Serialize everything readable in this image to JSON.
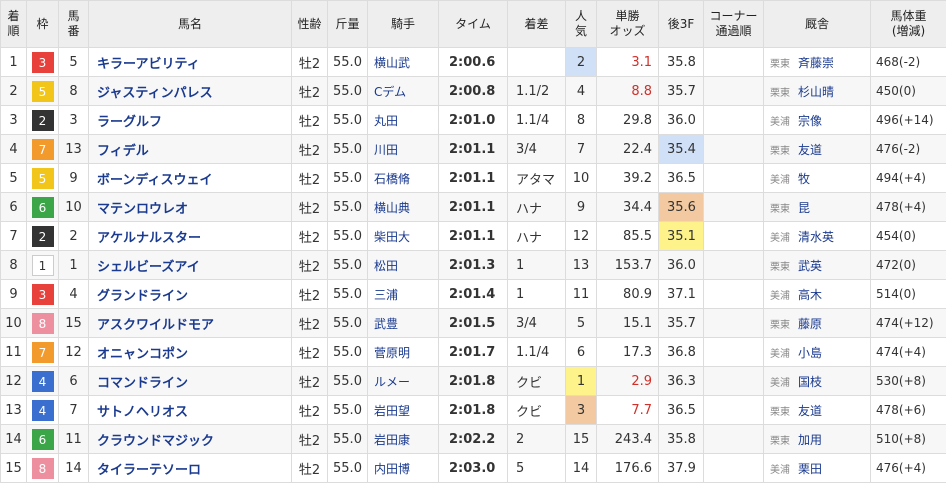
{
  "headers": [
    {
      "key": "rank",
      "lines": [
        "着",
        "順"
      ]
    },
    {
      "key": "waku",
      "lines": [
        "枠"
      ]
    },
    {
      "key": "num",
      "lines": [
        "馬",
        "番"
      ]
    },
    {
      "key": "horse",
      "lines": [
        "馬名"
      ]
    },
    {
      "key": "sexage",
      "lines": [
        "性齢"
      ]
    },
    {
      "key": "weight",
      "lines": [
        "斤量"
      ]
    },
    {
      "key": "jockey",
      "lines": [
        "騎手"
      ]
    },
    {
      "key": "time",
      "lines": [
        "タイム"
      ]
    },
    {
      "key": "margin",
      "lines": [
        "着差"
      ]
    },
    {
      "key": "pop",
      "lines": [
        "人",
        "気"
      ]
    },
    {
      "key": "odds",
      "lines": [
        "単勝",
        "オッズ"
      ]
    },
    {
      "key": "last3f",
      "lines": [
        "後3F"
      ]
    },
    {
      "key": "corner",
      "lines": [
        "コーナー",
        "通過順"
      ]
    },
    {
      "key": "trainer",
      "lines": [
        "厩舎"
      ]
    },
    {
      "key": "bodyweight",
      "lines": [
        "馬体重",
        "(増減)"
      ]
    }
  ],
  "waku_colors": {
    "1": {
      "bg": "#ffffff",
      "fg": "#333333",
      "border": "#cccccc"
    },
    "2": {
      "bg": "#333333",
      "fg": "#ffffff",
      "border": "#333333"
    },
    "3": {
      "bg": "#e8403a",
      "fg": "#ffffff",
      "border": "#e8403a"
    },
    "4": {
      "bg": "#3a6fcf",
      "fg": "#ffffff",
      "border": "#3a6fcf"
    },
    "5": {
      "bg": "#f2c51b",
      "fg": "#ffffff",
      "border": "#f2c51b"
    },
    "6": {
      "bg": "#3aa648",
      "fg": "#ffffff",
      "border": "#3aa648"
    },
    "7": {
      "bg": "#f39a2c",
      "fg": "#ffffff",
      "border": "#f39a2c"
    },
    "8": {
      "bg": "#ee8fa0",
      "fg": "#ffffff",
      "border": "#ee8fa0"
    }
  },
  "rows": [
    {
      "rank": "1",
      "waku": "3",
      "num": "5",
      "horse": "キラーアビリティ",
      "sexage": "牡2",
      "weight": "55.0",
      "jockey": "横山武",
      "time": "2:00.6",
      "margin": "",
      "pop": "2",
      "odds": "3.1",
      "odds_red": true,
      "last3f": "35.8",
      "last3f_hl": "",
      "corner": "",
      "region": "栗東",
      "trainer": "斉藤崇",
      "bodyweight": "468(-2)"
    },
    {
      "rank": "2",
      "waku": "5",
      "num": "8",
      "horse": "ジャスティンパレス",
      "sexage": "牡2",
      "weight": "55.0",
      "jockey": "Cデム",
      "time": "2:00.8",
      "margin": "1.1/2",
      "pop": "4",
      "odds": "8.8",
      "odds_red": true,
      "last3f": "35.7",
      "last3f_hl": "",
      "corner": "",
      "region": "栗東",
      "trainer": "杉山晴",
      "bodyweight": "450(0)"
    },
    {
      "rank": "3",
      "waku": "2",
      "num": "3",
      "horse": "ラーグルフ",
      "sexage": "牡2",
      "weight": "55.0",
      "jockey": "丸田",
      "time": "2:01.0",
      "margin": "1.1/4",
      "pop": "8",
      "odds": "29.8",
      "odds_red": false,
      "last3f": "36.0",
      "last3f_hl": "",
      "corner": "",
      "region": "美浦",
      "trainer": "宗像",
      "bodyweight": "496(+14)"
    },
    {
      "rank": "4",
      "waku": "7",
      "num": "13",
      "horse": "フィデル",
      "sexage": "牡2",
      "weight": "55.0",
      "jockey": "川田",
      "time": "2:01.1",
      "margin": "3/4",
      "pop": "7",
      "odds": "22.4",
      "odds_red": false,
      "last3f": "35.4",
      "last3f_hl": "pop2",
      "corner": "",
      "region": "栗東",
      "trainer": "友道",
      "bodyweight": "476(-2)"
    },
    {
      "rank": "5",
      "waku": "5",
      "num": "9",
      "horse": "ボーンディスウェイ",
      "sexage": "牡2",
      "weight": "55.0",
      "jockey": "石橋脩",
      "time": "2:01.1",
      "margin": "アタマ",
      "pop": "10",
      "odds": "39.2",
      "odds_red": false,
      "last3f": "36.5",
      "last3f_hl": "",
      "corner": "",
      "region": "美浦",
      "trainer": "牧",
      "bodyweight": "494(+4)"
    },
    {
      "rank": "6",
      "waku": "6",
      "num": "10",
      "horse": "マテンロウレオ",
      "sexage": "牡2",
      "weight": "55.0",
      "jockey": "横山典",
      "time": "2:01.1",
      "margin": "ハナ",
      "pop": "9",
      "odds": "34.4",
      "odds_red": false,
      "last3f": "35.6",
      "last3f_hl": "pop3",
      "corner": "",
      "region": "栗東",
      "trainer": "昆",
      "bodyweight": "478(+4)"
    },
    {
      "rank": "7",
      "waku": "2",
      "num": "2",
      "horse": "アケルナルスター",
      "sexage": "牡2",
      "weight": "55.0",
      "jockey": "柴田大",
      "time": "2:01.1",
      "margin": "ハナ",
      "pop": "12",
      "odds": "85.5",
      "odds_red": false,
      "last3f": "35.1",
      "last3f_hl": "pop1",
      "corner": "",
      "region": "美浦",
      "trainer": "清水英",
      "bodyweight": "454(0)"
    },
    {
      "rank": "8",
      "waku": "1",
      "num": "1",
      "horse": "シェルビーズアイ",
      "sexage": "牡2",
      "weight": "55.0",
      "jockey": "松田",
      "time": "2:01.3",
      "margin": "1",
      "pop": "13",
      "odds": "153.7",
      "odds_red": false,
      "last3f": "36.0",
      "last3f_hl": "",
      "corner": "",
      "region": "栗東",
      "trainer": "武英",
      "bodyweight": "472(0)"
    },
    {
      "rank": "9",
      "waku": "3",
      "num": "4",
      "horse": "グランドライン",
      "sexage": "牡2",
      "weight": "55.0",
      "jockey": "三浦",
      "time": "2:01.4",
      "margin": "1",
      "pop": "11",
      "odds": "80.9",
      "odds_red": false,
      "last3f": "37.1",
      "last3f_hl": "",
      "corner": "",
      "region": "美浦",
      "trainer": "高木",
      "bodyweight": "514(0)"
    },
    {
      "rank": "10",
      "waku": "8",
      "num": "15",
      "horse": "アスクワイルドモア",
      "sexage": "牡2",
      "weight": "55.0",
      "jockey": "武豊",
      "time": "2:01.5",
      "margin": "3/4",
      "pop": "5",
      "odds": "15.1",
      "odds_red": false,
      "last3f": "35.7",
      "last3f_hl": "",
      "corner": "",
      "region": "栗東",
      "trainer": "藤原",
      "bodyweight": "474(+12)"
    },
    {
      "rank": "11",
      "waku": "7",
      "num": "12",
      "horse": "オニャンコポン",
      "sexage": "牡2",
      "weight": "55.0",
      "jockey": "菅原明",
      "time": "2:01.7",
      "margin": "1.1/4",
      "pop": "6",
      "odds": "17.3",
      "odds_red": false,
      "last3f": "36.8",
      "last3f_hl": "",
      "corner": "",
      "region": "美浦",
      "trainer": "小島",
      "bodyweight": "474(+4)"
    },
    {
      "rank": "12",
      "waku": "4",
      "num": "6",
      "horse": "コマンドライン",
      "sexage": "牡2",
      "weight": "55.0",
      "jockey": "ルメー",
      "time": "2:01.8",
      "margin": "クビ",
      "pop": "1",
      "odds": "2.9",
      "odds_red": true,
      "last3f": "36.3",
      "last3f_hl": "",
      "corner": "",
      "region": "美浦",
      "trainer": "国枝",
      "bodyweight": "530(+8)"
    },
    {
      "rank": "13",
      "waku": "4",
      "num": "7",
      "horse": "サトノヘリオス",
      "sexage": "牡2",
      "weight": "55.0",
      "jockey": "岩田望",
      "time": "2:01.8",
      "margin": "クビ",
      "pop": "3",
      "odds": "7.7",
      "odds_red": true,
      "last3f": "36.5",
      "last3f_hl": "",
      "corner": "",
      "region": "栗東",
      "trainer": "友道",
      "bodyweight": "478(+6)"
    },
    {
      "rank": "14",
      "waku": "6",
      "num": "11",
      "horse": "クラウンドマジック",
      "sexage": "牡2",
      "weight": "55.0",
      "jockey": "岩田康",
      "time": "2:02.2",
      "margin": "2",
      "pop": "15",
      "odds": "243.4",
      "odds_red": false,
      "last3f": "35.8",
      "last3f_hl": "",
      "corner": "",
      "region": "栗東",
      "trainer": "加用",
      "bodyweight": "510(+8)"
    },
    {
      "rank": "15",
      "waku": "8",
      "num": "14",
      "horse": "タイラーテソーロ",
      "sexage": "牡2",
      "weight": "55.0",
      "jockey": "内田博",
      "time": "2:03.0",
      "margin": "5",
      "pop": "14",
      "odds": "176.6",
      "odds_red": false,
      "last3f": "37.9",
      "last3f_hl": "",
      "corner": "",
      "region": "美浦",
      "trainer": "栗田",
      "bodyweight": "476(+4)"
    }
  ]
}
